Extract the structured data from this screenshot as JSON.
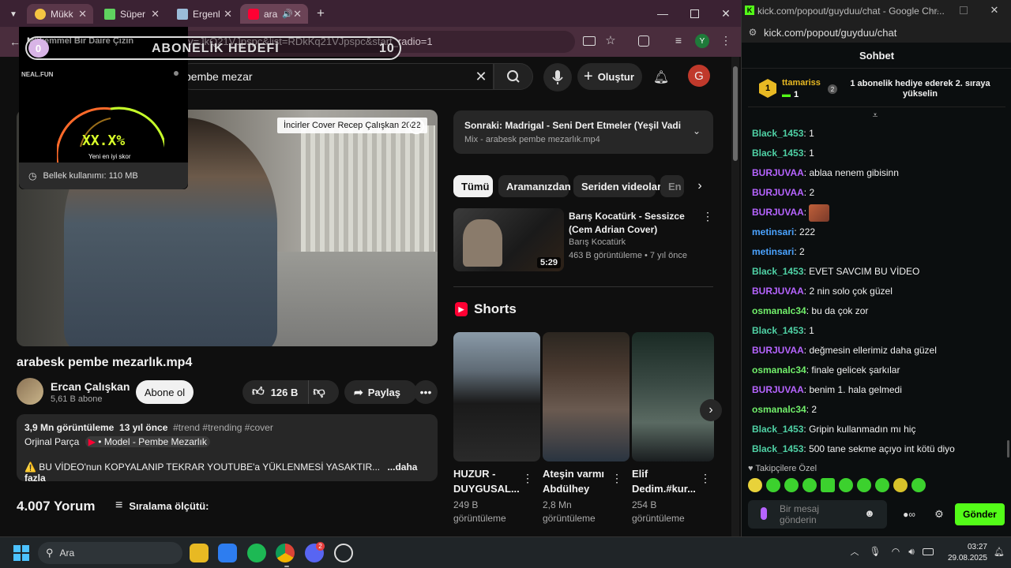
{
  "browser": {
    "tabs": [
      {
        "label": "Mükk",
        "color": "#f5c542"
      },
      {
        "label": "Süper",
        "color": "#5fd35f"
      },
      {
        "label": "Ergenl",
        "color": "#9bbcd9"
      },
      {
        "label": "ara",
        "color": "#ff0033"
      }
    ],
    "url_text": "v=JkQ21VJpspc&list=RDkKq21VJpspc&start_radio=1"
  },
  "youtube": {
    "search_value": "pembe mezar",
    "create_label": "Oluştur",
    "avatar_letter": "G",
    "video_overlay_label": "İncirler Cover Recep Çalışkan 2022",
    "video_title": "arabesk pembe mezarlık.mp4",
    "channel_name": "Ercan Çalışkan",
    "channel_subs": "5,61 B abone",
    "subscribe_label": "Abone ol",
    "like_count": "126 B",
    "share_label": "Paylaş",
    "desc": {
      "views": "3,9 Mn görüntüleme",
      "age": "13 yıl önce",
      "tags": "#trend #trending #cover",
      "line2_prefix": "Orjinal Parça",
      "line2_link": "• Model - Pembe Mezarlık",
      "line3": "⚠️ BU VİDEO'nun KOPYALANIP TEKRAR YOUTUBE'a YÜKLENMESİ YASAKTIR...",
      "more": "...daha fazla"
    },
    "comments_count": "4.007 Yorum",
    "sort_label": "Sıralama ölçütü:",
    "next_title": "Sonraki: Madrigal - Seni Dert Etmeler (Yeşil Vadi Li...",
    "next_sub": "Mix - arabesk pembe mezarlık.mp4",
    "chips": [
      "Tümü",
      "Aramanızdan",
      "Seriden videolar",
      "En"
    ],
    "rec": {
      "title1": "Barış Kocatürk - Sessizce",
      "title2": "(Cem Adrian Cover)",
      "channel": "Barış Kocatürk",
      "meta": "463 B görüntüleme • 7 yıl önce",
      "duration": "5:29"
    },
    "shorts_label": "Shorts",
    "shorts": [
      {
        "title1": "HUZUR -",
        "title2": "DUYGUSAL...",
        "views1": "249 B",
        "views2": "görüntüleme"
      },
      {
        "title1": "Ateşin varmı",
        "title2": "Abdülhey",
        "views1": "2,8 Mn",
        "views2": "görüntüleme"
      },
      {
        "title1": "Elif",
        "title2": "Dedim.#kur...",
        "views1": "254 B",
        "views2": "görüntüleme"
      }
    ]
  },
  "overlay": {
    "widget_header": "Mükemmel Bir Daire Çizin",
    "widget_brand": "NEAL.FUN",
    "score": "XX.X%",
    "best": "Yeni en iyi skor",
    "goal_label": "ABONELİK HEDEFİ",
    "goal_current": "0",
    "goal_target": "10",
    "memory": "Bellek kullanımı: 110 MB"
  },
  "kick": {
    "window_title": "kick.com/popout/guyduu/chat - Google Chr...",
    "url": "kick.com/popout/guyduu/chat",
    "header": "Sohbet",
    "pinned_user": "ttamariss",
    "pinned_count": "1",
    "pinned_rank": "2",
    "pinned_text": "1 abonelik hediye ederek 2. sıraya yükselin",
    "messages": [
      {
        "user": "Black_1453",
        "text": "1",
        "color": "#4fd1a5"
      },
      {
        "user": "Black_1453",
        "text": "1",
        "color": "#4fd1a5"
      },
      {
        "user": "BURJUVAA",
        "text": "ablaa nenem gibisinn",
        "color": "#b664ff"
      },
      {
        "user": "BURJUVAA",
        "text": "2",
        "color": "#b664ff"
      },
      {
        "user": "BURJUVAA",
        "text": "",
        "color": "#b664ff"
      },
      {
        "user": "metinsari",
        "text": "222",
        "color": "#4ba3ff"
      },
      {
        "user": "metinsari",
        "text": "2",
        "color": "#4ba3ff"
      },
      {
        "user": "Black_1453",
        "text": "EVET SAVCIM BU VİDEO",
        "color": "#4fd1a5"
      },
      {
        "user": "BURJUVAA",
        "text": "2 nin solo çok güzel",
        "color": "#b664ff"
      },
      {
        "user": "osmanalc34",
        "text": "bu da çok zor",
        "color": "#72f06b"
      },
      {
        "user": "Black_1453",
        "text": "1",
        "color": "#4fd1a5"
      },
      {
        "user": "BURJUVAA",
        "text": "değmesin ellerimiz daha güzel",
        "color": "#b664ff"
      },
      {
        "user": "osmanalc34",
        "text": "finale gelicek şarkılar",
        "color": "#72f06b"
      },
      {
        "user": "BURJUVAA",
        "text": "benim 1. hala gelmedi",
        "color": "#b664ff"
      },
      {
        "user": "osmanalc34",
        "text": "2",
        "color": "#72f06b"
      },
      {
        "user": "Black_1453",
        "text": "Gripin kullanmadın mı hiç",
        "color": "#4fd1a5"
      },
      {
        "user": "Black_1453",
        "text": "500 tane sekme açıyo int kötü diyo",
        "color": "#4fd1a5"
      }
    ],
    "followers_only": "Takipçilere Özel",
    "input_placeholder": "Bir mesaj gönderin",
    "send_label": "Gönder",
    "accent": "#53fc18"
  },
  "taskbar": {
    "search_label": "Ara",
    "time": "03:27",
    "date": "29.08.2025",
    "discord_badge": "2"
  }
}
